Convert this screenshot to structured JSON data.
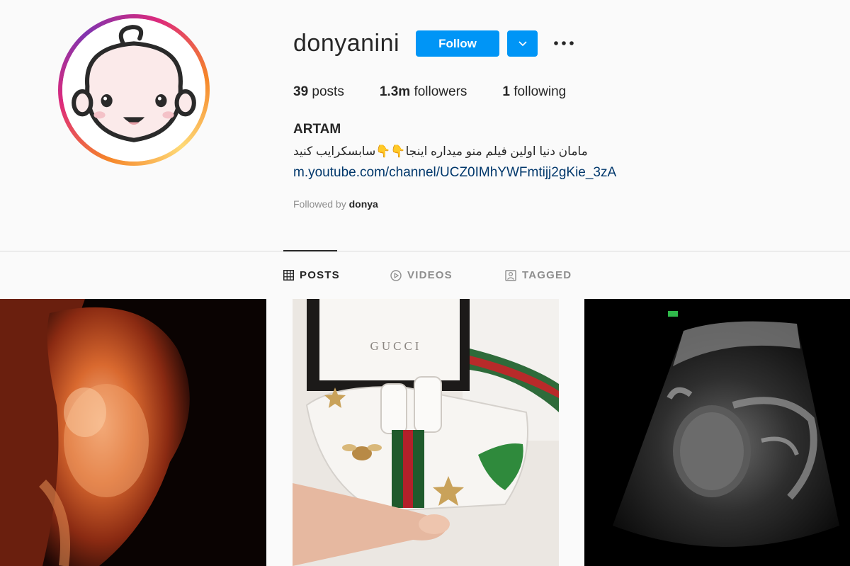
{
  "profile": {
    "username": "donyanini",
    "follow_label": "Follow",
    "posts_count": "39",
    "posts_label": "posts",
    "followers_count": "1.3m",
    "followers_label": "followers",
    "following_count": "1",
    "following_label": "following",
    "full_name": "ARTAM",
    "bio": "مامان دنیا اولین فیلم منو میداره اینجا👇👇سابسکرایب کنید",
    "link": "m.youtube.com/channel/UCZ0IMhYWFmtijj2gKie_3zA",
    "followed_by_prefix": "Followed by",
    "followed_by_user": "donya"
  },
  "tabs": [
    {
      "label": "POSTS",
      "icon": "grid-icon",
      "active": true
    },
    {
      "label": "VIDEOS",
      "icon": "play-icon",
      "active": false
    },
    {
      "label": "TAGGED",
      "icon": "tag-icon",
      "active": false
    }
  ],
  "posts": [
    {
      "subject": "3d-ultrasound"
    },
    {
      "subject": "gucci-baby-sneakers",
      "box_text": "GUCCI"
    },
    {
      "subject": "ultrasound-scan"
    }
  ],
  "colors": {
    "accent": "#0095f6",
    "link": "#00376b",
    "muted": "#8e8e8e",
    "text": "#262626"
  }
}
